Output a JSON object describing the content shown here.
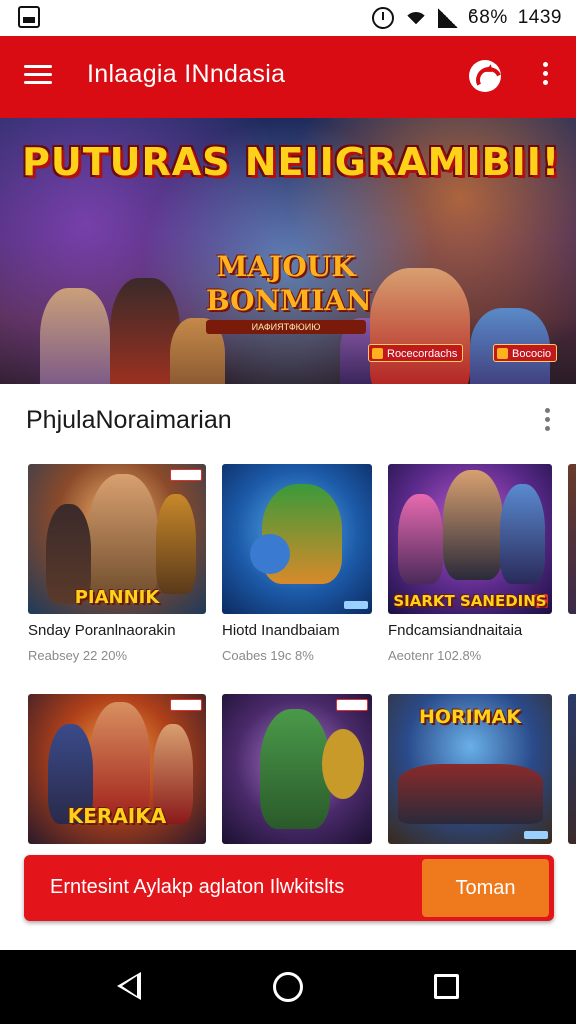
{
  "status_bar": {
    "battery_text": "ϐ8%",
    "time": "1439",
    "icons": [
      "image-icon",
      "alarm-icon",
      "wifi-icon",
      "signal-icon"
    ]
  },
  "app_bar": {
    "title": "Inlaagia INndasia",
    "color": "#d80c12",
    "icons": [
      "menu-icon",
      "refresh-icon",
      "overflow-menu-icon"
    ]
  },
  "banner": {
    "headline": "PUTURAS NEIIGRAMIBII!",
    "logo_line1": "MAJOUK",
    "logo_line2": "BONMIAN",
    "logo_subtitle": "ИАФИЯТФЮИЮ",
    "badges": [
      "Rocecordachs",
      "Bococio"
    ]
  },
  "section": {
    "title": "PhjulaNoraimarian",
    "more_icon": "more-vertical-icon"
  },
  "cards_row1": [
    {
      "caption": "PIANNIK",
      "title": "Snday Poranlnaorakin",
      "subtitle": "Reabsey 22 20%"
    },
    {
      "caption": "",
      "title": "Hiotd Inandbaiam",
      "subtitle": "Coabes 19c 8%"
    },
    {
      "caption": "SIARKT SANEDINS",
      "title": "Fndcamsiandnaitaia",
      "subtitle": "Aeotenr 102.8%"
    }
  ],
  "cards_row2": [
    {
      "caption": "KERAIKA"
    },
    {
      "caption": ""
    },
    {
      "caption": "HORIMAK"
    }
  ],
  "cta": {
    "text": "Erntesint Aylakp aglaton Ilwkitslts",
    "button": "Toman",
    "bar_color": "#e3141a",
    "button_color": "#ee7a1d"
  },
  "nav_bar": {
    "icons": [
      "back-icon",
      "home-icon",
      "recents-icon"
    ]
  }
}
